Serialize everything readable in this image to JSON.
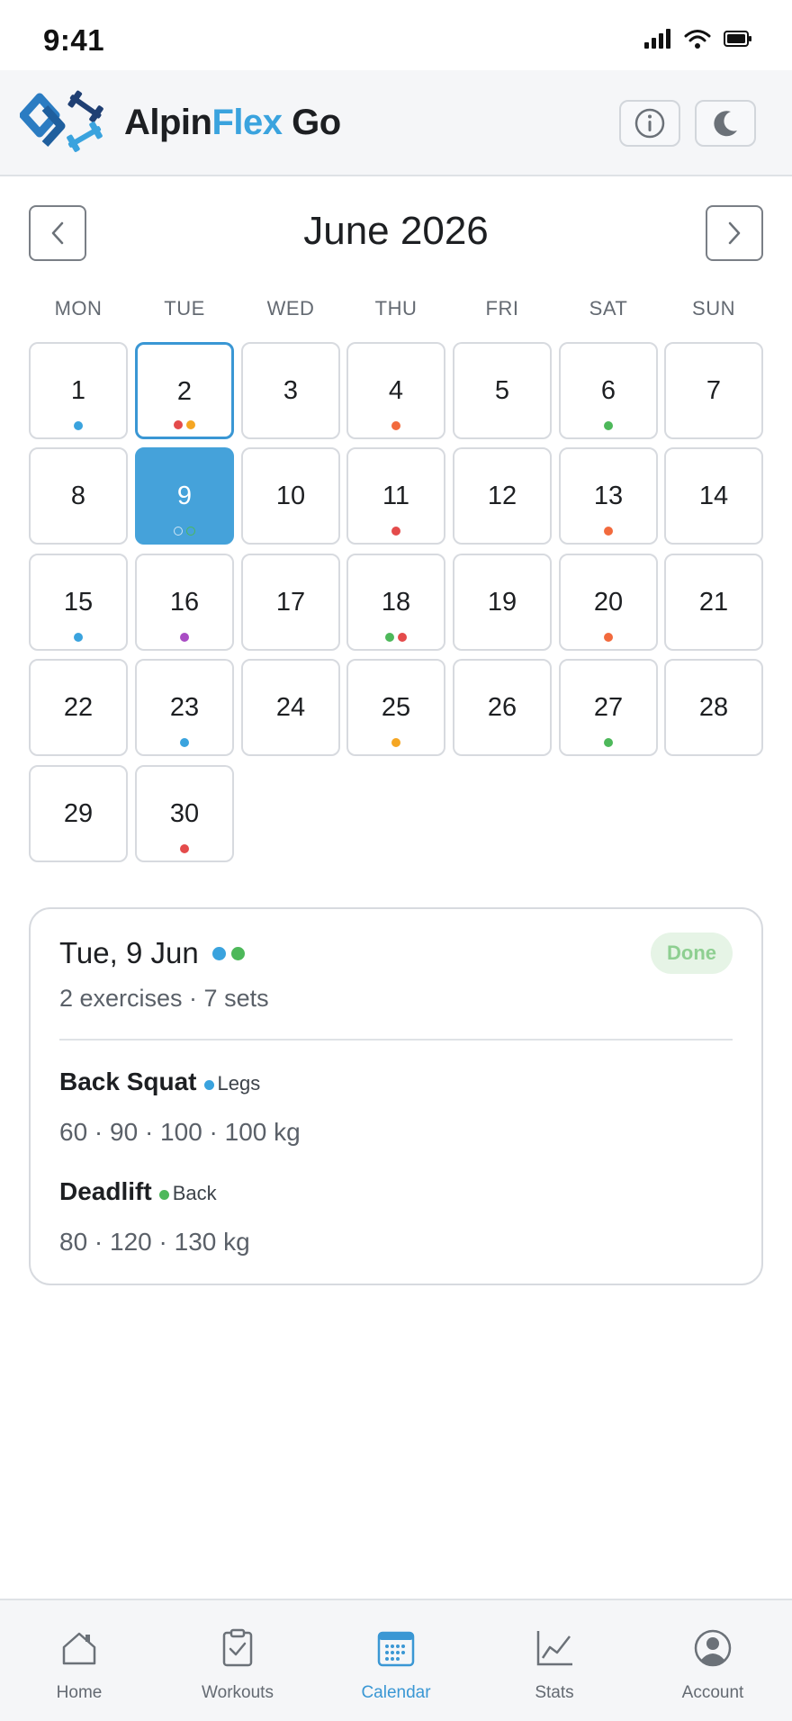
{
  "status": {
    "time": "9:41"
  },
  "header": {
    "brand_part1": "Alpin",
    "brand_part2": "Flex",
    "brand_part3": " Go"
  },
  "calendar": {
    "month_label": "June 2026",
    "weekdays": [
      "MON",
      "TUE",
      "WED",
      "THU",
      "FRI",
      "SAT",
      "SUN"
    ],
    "days": [
      {
        "n": "1",
        "dots": [
          "#3aa3de"
        ]
      },
      {
        "n": "2",
        "dots": [
          "#e44b4b",
          "#f5a623"
        ],
        "today": true
      },
      {
        "n": "3",
        "dots": []
      },
      {
        "n": "4",
        "dots": [
          "#f26a3d"
        ]
      },
      {
        "n": "5",
        "dots": []
      },
      {
        "n": "6",
        "dots": [
          "#4db85a"
        ]
      },
      {
        "n": "7",
        "dots": []
      },
      {
        "n": "8",
        "dots": []
      },
      {
        "n": "9",
        "dots": [
          "#3aa3de",
          "#4db85a"
        ],
        "selected": true
      },
      {
        "n": "10",
        "dots": []
      },
      {
        "n": "11",
        "dots": [
          "#e44b4b"
        ]
      },
      {
        "n": "12",
        "dots": []
      },
      {
        "n": "13",
        "dots": [
          "#f26a3d"
        ]
      },
      {
        "n": "14",
        "dots": []
      },
      {
        "n": "15",
        "dots": [
          "#3aa3de"
        ]
      },
      {
        "n": "16",
        "dots": [
          "#a94cc4"
        ]
      },
      {
        "n": "17",
        "dots": []
      },
      {
        "n": "18",
        "dots": [
          "#4db85a",
          "#e44b4b"
        ]
      },
      {
        "n": "19",
        "dots": []
      },
      {
        "n": "20",
        "dots": [
          "#f26a3d"
        ]
      },
      {
        "n": "21",
        "dots": []
      },
      {
        "n": "22",
        "dots": []
      },
      {
        "n": "23",
        "dots": [
          "#3aa3de"
        ]
      },
      {
        "n": "24",
        "dots": []
      },
      {
        "n": "25",
        "dots": [
          "#f5a623"
        ]
      },
      {
        "n": "26",
        "dots": []
      },
      {
        "n": "27",
        "dots": [
          "#4db85a"
        ]
      },
      {
        "n": "28",
        "dots": []
      },
      {
        "n": "29",
        "dots": []
      },
      {
        "n": "30",
        "dots": [
          "#e44b4b"
        ]
      }
    ]
  },
  "detail": {
    "date": "Tue, 9 Jun",
    "dots": [
      "#3aa3de",
      "#4db85a"
    ],
    "badge": "Done",
    "summary": "2 exercises · 7 sets",
    "exercises": [
      {
        "name": "Back Squat",
        "tag": "Legs",
        "color": "#3aa3de",
        "sets": "60 · 90 · 100 · 100 kg"
      },
      {
        "name": "Deadlift",
        "tag": "Back",
        "color": "#4db85a",
        "sets": "80 · 120 · 130 kg"
      }
    ]
  },
  "nav": {
    "tabs": [
      {
        "label": "Home",
        "icon": "home-icon"
      },
      {
        "label": "Workouts",
        "icon": "clipboard-check-icon"
      },
      {
        "label": "Calendar",
        "icon": "calendar-icon",
        "active": true
      },
      {
        "label": "Stats",
        "icon": "line-chart-icon"
      },
      {
        "label": "Account",
        "icon": "account-icon"
      }
    ]
  },
  "colors": {
    "accent": "#3aa3de",
    "selected": "#45a2da",
    "done_badge_bg": "#e6f4e6",
    "done_badge_text": "#8ecf91"
  }
}
